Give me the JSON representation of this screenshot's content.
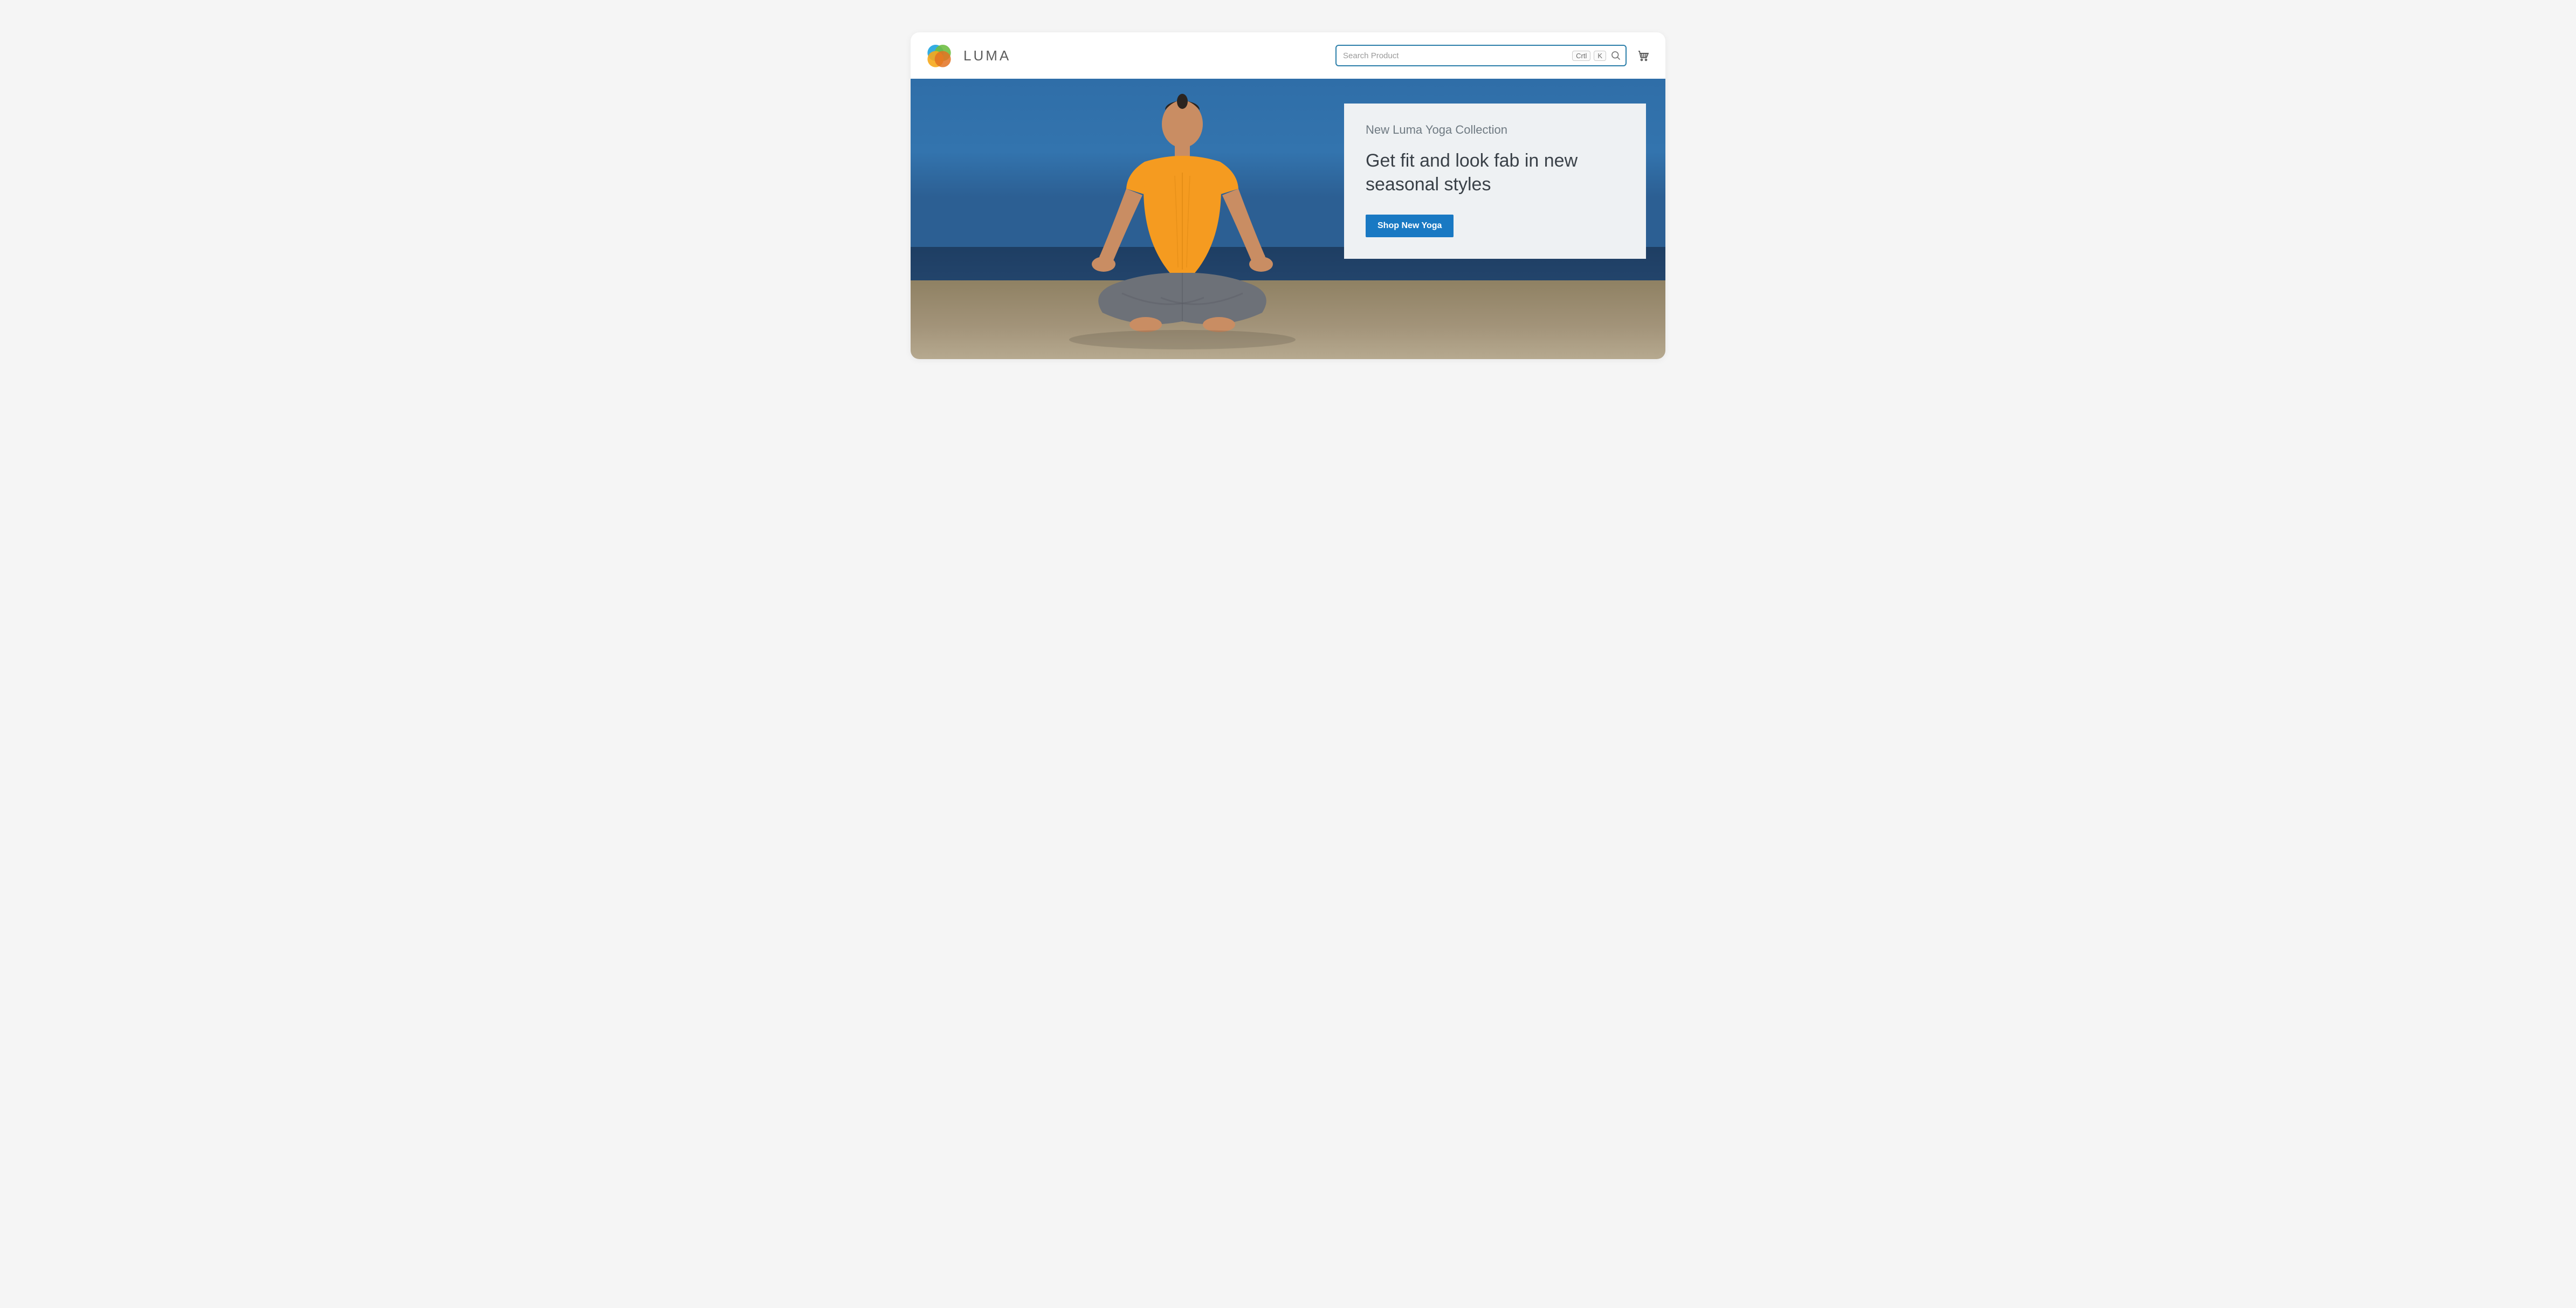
{
  "brand": {
    "name": "LUMA"
  },
  "search": {
    "placeholder": "Search Product",
    "shortcut_mod": "Crtl",
    "shortcut_key": "K"
  },
  "hero": {
    "eyebrow": "New Luma Yoga Collection",
    "headline": "Get fit and look fab in new seasonal styles",
    "cta": "Shop New Yoga"
  },
  "icons": {
    "search": "search-icon",
    "cart": "cart-icon",
    "logo": "luma-logo"
  },
  "colors": {
    "accent": "#1979c3",
    "search_border": "#2b7ea9"
  }
}
